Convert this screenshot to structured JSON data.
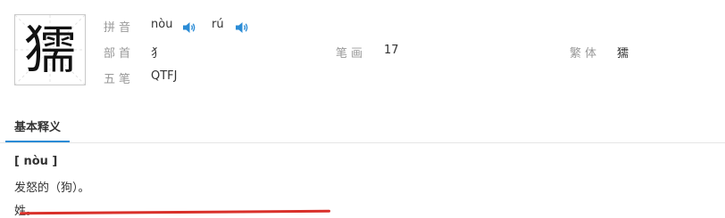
{
  "character": "獳",
  "info": {
    "pinyin_label": "拼音",
    "pinyin_readings": [
      "nòu",
      "rú"
    ],
    "radical_label": "部首",
    "radical": "犭",
    "strokes_label": "笔画",
    "strokes": "17",
    "traditional_label": "繁体",
    "traditional": "獳",
    "wubi_label": "五笔",
    "wubi": "QTFJ"
  },
  "tabs": [
    "基本释义"
  ],
  "definition": {
    "pronunciation": "[ nòu ]",
    "meanings": [
      "发怒的（狗）。",
      "姓。"
    ]
  },
  "colors": {
    "speaker_icon": "#2b8cd6",
    "tab_underline": "#2b8cd6",
    "annotation_line": "#d9302a"
  }
}
